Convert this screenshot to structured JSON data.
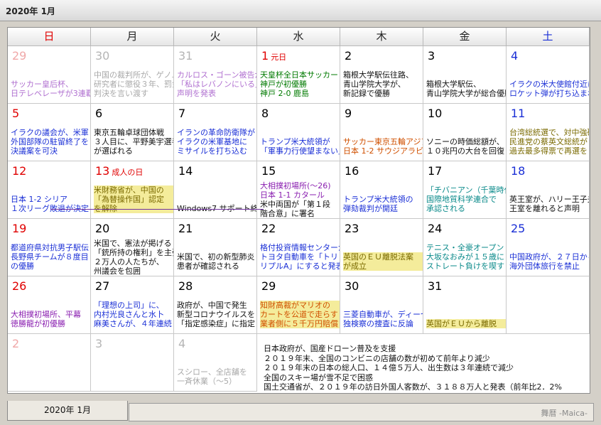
{
  "window": {
    "title": "2020年 1月"
  },
  "weekdays": [
    {
      "label": "日",
      "kind": "sun"
    },
    {
      "label": "月",
      "kind": ""
    },
    {
      "label": "火",
      "kind": ""
    },
    {
      "label": "水",
      "kind": ""
    },
    {
      "label": "木",
      "kind": ""
    },
    {
      "label": "金",
      "kind": ""
    },
    {
      "label": "土",
      "kind": "sat"
    }
  ],
  "weeks": [
    [
      {
        "day": "29",
        "kind": "sun",
        "other": true,
        "events": [
          {
            "text": "",
            "color": "gray"
          },
          {
            "text": "サッカー皇后杯、",
            "color": "lilac"
          },
          {
            "text": "日テレベレーザが3連覇",
            "color": "lilac"
          }
        ]
      },
      {
        "day": "30",
        "other": true,
        "events": [
          {
            "text": "中国の裁判所が、ゲノム",
            "color": "gray"
          },
          {
            "text": "研究者に懲役３年、罰金",
            "color": "gray"
          },
          {
            "text": "判決を言い渡す",
            "color": "gray"
          }
        ]
      },
      {
        "day": "31",
        "other": true,
        "events": [
          {
            "text": "カルロス・ゴーン被告が",
            "color": "lilac"
          },
          {
            "text": "「私はレバノンにいる」",
            "color": "lilac"
          },
          {
            "text": "声明を発表",
            "color": "lilac"
          }
        ]
      },
      {
        "day": "1",
        "kind": "hol",
        "holiday": "元日",
        "events": [
          {
            "text": "天皇杯全日本サッカー",
            "color": "green"
          },
          {
            "text": "神戸が初優勝",
            "color": "green"
          },
          {
            "text": "神戸 2-0 鹿島",
            "color": "green"
          }
        ]
      },
      {
        "day": "2",
        "events": [
          {
            "text": "箱根大学駅伝往路、",
            "color": "black"
          },
          {
            "text": "青山学院大学が、",
            "color": "black"
          },
          {
            "text": "新記録で優勝",
            "color": "black"
          }
        ]
      },
      {
        "day": "3",
        "events": [
          {
            "text": "",
            "color": "black"
          },
          {
            "text": "箱根大学駅伝、",
            "color": "black"
          },
          {
            "text": "青山学院大学が総合優勝",
            "color": "black"
          }
        ]
      },
      {
        "day": "4",
        "kind": "sat",
        "events": [
          {
            "text": "",
            "color": "blue"
          },
          {
            "text": "イラクの米大使館付近に",
            "color": "blue"
          },
          {
            "text": "ロケット弾が打ち込まれる",
            "color": "blue"
          }
        ]
      }
    ],
    [
      {
        "day": "5",
        "kind": "sun",
        "events": [
          {
            "text": "イラクの議会が、米軍",
            "color": "blue"
          },
          {
            "text": "外国部隊の駐留終了を",
            "color": "blue"
          },
          {
            "text": "決議案を可決",
            "color": "blue"
          }
        ]
      },
      {
        "day": "6",
        "events": [
          {
            "text": "東京五輪卓球団体戦",
            "color": "black"
          },
          {
            "text": "３人目に、平野美宇選手",
            "color": "black"
          },
          {
            "text": "が選ばれる",
            "color": "black"
          }
        ]
      },
      {
        "day": "7",
        "events": [
          {
            "text": "イランの革命防衛隊が",
            "color": "blue"
          },
          {
            "text": "イラクの米軍基地に",
            "color": "blue"
          },
          {
            "text": "ミサイルを打ち込む",
            "color": "blue"
          }
        ]
      },
      {
        "day": "8",
        "events": [
          {
            "text": "",
            "color": "blue"
          },
          {
            "text": "トランプ米大統領が",
            "color": "blue"
          },
          {
            "text": "「軍事力行使望まない」",
            "color": "blue"
          }
        ]
      },
      {
        "day": "9",
        "events": [
          {
            "text": "",
            "color": "orange"
          },
          {
            "text": "サッカー東京五輪アジア",
            "color": "orange"
          },
          {
            "text": "日本 1-2 サウジアラビア",
            "color": "orange"
          }
        ]
      },
      {
        "day": "10",
        "events": [
          {
            "text": "",
            "color": "black"
          },
          {
            "text": "ソニーの時価総額が、",
            "color": "black"
          },
          {
            "text": "１０兆円の大台を回復",
            "color": "black"
          }
        ]
      },
      {
        "day": "11",
        "kind": "sat",
        "events": [
          {
            "text": "台湾総統選で、対中強硬",
            "color": "olive"
          },
          {
            "text": "民進党の蔡英文総統が",
            "color": "olive"
          },
          {
            "text": "過去最多得票で再選を",
            "color": "olive"
          }
        ]
      }
    ],
    [
      {
        "day": "12",
        "kind": "sun",
        "events": [
          {
            "text": "",
            "color": "blue"
          },
          {
            "text": "日本 1-2 シリア",
            "color": "blue"
          },
          {
            "text": "１次リーグ敗退が決定",
            "color": "blue"
          }
        ]
      },
      {
        "day": "13",
        "kind": "hol",
        "holiday": "成人の日",
        "events": [
          {
            "text": "米財務省が、中国の",
            "color": "olive",
            "hl": true
          },
          {
            "text": "「為替操作国」認定",
            "color": "olive",
            "hl": true
          },
          {
            "text": "を解除",
            "color": "olive",
            "hl": true
          }
        ]
      },
      {
        "day": "14",
        "events": [
          {
            "text": "",
            "color": "black"
          },
          {
            "text": "",
            "color": "black"
          },
          {
            "text": "Windows7 サポート終了",
            "color": "black"
          }
        ]
      },
      {
        "day": "15",
        "events": [
          {
            "text": "大相撲初場所(～26)",
            "color": "purple"
          },
          {
            "text": "日本 1-1 カタール",
            "color": "purple"
          },
          {
            "text": "米中両国が「第１段",
            "color": "black"
          },
          {
            "text": "階合意」に署名",
            "color": "black"
          }
        ]
      },
      {
        "day": "16",
        "events": [
          {
            "text": "",
            "color": "blue"
          },
          {
            "text": "トランプ米大統領の",
            "color": "blue"
          },
          {
            "text": "弾劾裁判が開廷",
            "color": "blue"
          }
        ]
      },
      {
        "day": "17",
        "events": [
          {
            "text": "「チバニアン（千葉時代",
            "color": "teal"
          },
          {
            "text": "国際地質科学連合で",
            "color": "teal"
          },
          {
            "text": "承認される",
            "color": "teal"
          }
        ]
      },
      {
        "day": "18",
        "kind": "sat",
        "events": [
          {
            "text": "",
            "color": "black"
          },
          {
            "text": "英王室が、ハリー王子夫妻",
            "color": "black"
          },
          {
            "text": "王室を離れると声明",
            "color": "black"
          }
        ]
      }
    ],
    [
      {
        "day": "19",
        "kind": "sun",
        "events": [
          {
            "text": "都道府県対抗男子駅伝",
            "color": "blue"
          },
          {
            "text": "長野県チームが８度目",
            "color": "blue"
          },
          {
            "text": "の優勝",
            "color": "blue"
          }
        ]
      },
      {
        "day": "20",
        "events": [
          {
            "text": "米国で、憲法が掲げる",
            "color": "black"
          },
          {
            "text": "「銃所持の権利」を主張",
            "color": "black"
          },
          {
            "text": "２万人の人たちが、",
            "color": "black"
          },
          {
            "text": "州議会を包囲",
            "color": "black"
          }
        ]
      },
      {
        "day": "21",
        "events": [
          {
            "text": "",
            "color": "black"
          },
          {
            "text": "米国で、初の新型肺炎",
            "color": "black"
          },
          {
            "text": "患者が確認される",
            "color": "black"
          }
        ]
      },
      {
        "day": "22",
        "events": [
          {
            "text": "格付投資情報センターが",
            "color": "blue"
          },
          {
            "text": "トヨタ自動車を「トリ",
            "color": "blue"
          },
          {
            "text": "リプルA」にすると発表",
            "color": "blue"
          }
        ]
      },
      {
        "day": "23",
        "events": [
          {
            "text": "",
            "color": "olive"
          },
          {
            "text": "英国のＥＵ離脱法案",
            "color": "olive",
            "hl": true
          },
          {
            "text": "が成立",
            "color": "olive",
            "hl": true
          }
        ]
      },
      {
        "day": "24",
        "events": [
          {
            "text": "テニス・全豪オープン",
            "color": "teal"
          },
          {
            "text": "大坂なおみが１５歳に",
            "color": "teal"
          },
          {
            "text": "ストレート負けを喫す",
            "color": "teal"
          }
        ]
      },
      {
        "day": "25",
        "kind": "sat",
        "events": [
          {
            "text": "",
            "color": "blue"
          },
          {
            "text": "中国政府が、２７日から",
            "color": "blue"
          },
          {
            "text": "海外団体旅行を禁止",
            "color": "blue"
          }
        ]
      }
    ],
    [
      {
        "day": "26",
        "kind": "sun",
        "events": [
          {
            "text": "",
            "color": "purple"
          },
          {
            "text": "大相撲初場所、平幕",
            "color": "purple"
          },
          {
            "text": "徳勝龍が初優勝",
            "color": "purple"
          }
        ]
      },
      {
        "day": "27",
        "events": [
          {
            "text": "「理想の上司」に、",
            "color": "blue"
          },
          {
            "text": "内村光良さんと水卜",
            "color": "blue"
          },
          {
            "text": "麻美さんが、４年連続",
            "color": "blue"
          }
        ]
      },
      {
        "day": "28",
        "events": [
          {
            "text": "政府が、中国で発生",
            "color": "black"
          },
          {
            "text": "新型コロナウイルスを",
            "color": "black"
          },
          {
            "text": "「指定感染症」に指定",
            "color": "black"
          }
        ]
      },
      {
        "day": "29",
        "events": [
          {
            "text": "知財高裁がマリオの",
            "color": "orange",
            "hl": true
          },
          {
            "text": "カートを公道で走らす",
            "color": "orange",
            "hl": true
          },
          {
            "text": "業者側に５千万円賠償",
            "color": "orange",
            "hl": true
          }
        ]
      },
      {
        "day": "30",
        "events": [
          {
            "text": "",
            "color": "blue"
          },
          {
            "text": "三菱自動車が、ディーゼル",
            "color": "blue"
          },
          {
            "text": "独検察の捜査に反論",
            "color": "blue"
          }
        ]
      },
      {
        "day": "31",
        "events": [
          {
            "text": "",
            "color": "olive"
          },
          {
            "text": "",
            "color": "olive"
          },
          {
            "text": "英国がＥＵから離脱",
            "color": "olive",
            "hl": true
          }
        ]
      },
      {
        "day": "",
        "kind": "",
        "empty": true,
        "events": []
      }
    ],
    [
      {
        "day": "2",
        "kind": "sun",
        "other": true,
        "events": []
      },
      {
        "day": "3",
        "other": true,
        "events": []
      },
      {
        "day": "4",
        "other": true,
        "events": [
          {
            "text": "",
            "color": "gray"
          },
          {
            "text": "スシロー、全店舗を",
            "color": "gray"
          },
          {
            "text": "一斉休業（～5）",
            "color": "gray"
          }
        ]
      }
    ]
  ],
  "notes": [
    "日本政府が、国産ドローン普及を支援",
    "２０１９年末、全国のコンビニの店舗の数が初めて前年より減少",
    "２０１９年末の日本の総人口、１４億５万人、出生数は３年連続で減少",
    "全国のスキー場が雪不足で困惑",
    "国土交通省が、２０１９年の訪日外国人客数が、３１８８万人と発表（前年比2．2%"
  ],
  "bottom": {
    "tab_label": "2020年 1月",
    "brand": "舞暦 -Maica-"
  }
}
